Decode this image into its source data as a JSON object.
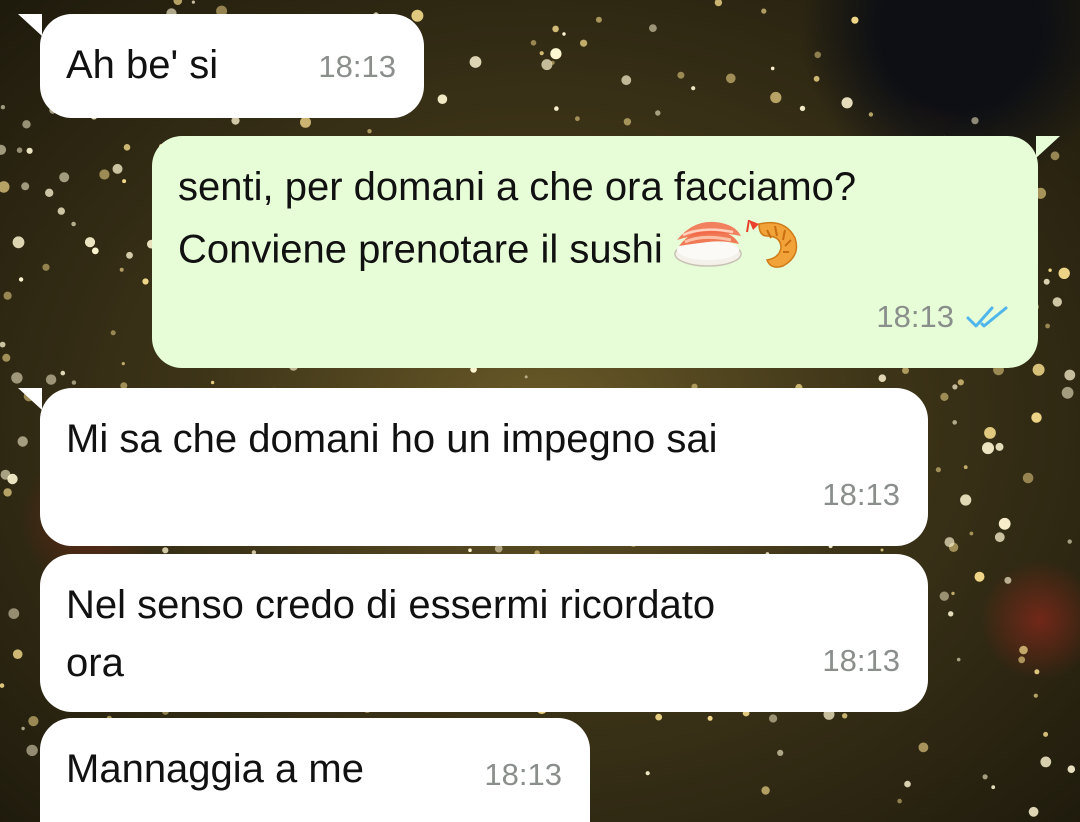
{
  "messages": [
    {
      "direction": "in",
      "text": "Ah be' si",
      "time": "18:13"
    },
    {
      "direction": "out",
      "text": "senti, per domani a che ora facciamo?\nConviene prenotare il sushi",
      "emoji": [
        "sushi-icon",
        "fried-shrimp-icon"
      ],
      "time": "18:13",
      "status": "read"
    },
    {
      "direction": "in",
      "text": "Mi sa che domani ho un impegno sai",
      "time": "18:13"
    },
    {
      "direction": "in",
      "text": "Nel senso credo di essermi ricordato\nora",
      "time": "18:13"
    },
    {
      "direction": "in",
      "text": "Mannaggia a me",
      "time": "18:13"
    }
  ],
  "colors": {
    "incoming_bubble": "#ffffff",
    "outgoing_bubble": "#e7fdd8",
    "timestamp": "#8a8f8c",
    "read_ticks": "#4fb6ec"
  }
}
